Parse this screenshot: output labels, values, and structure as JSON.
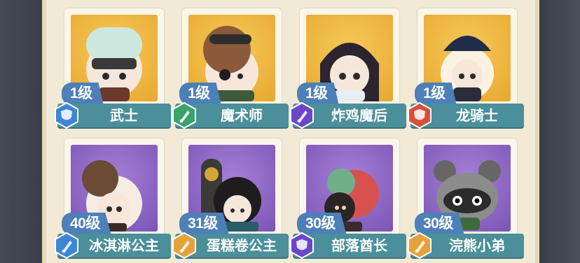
{
  "heroes": [
    {
      "level": "1级",
      "name": "武士",
      "badge": "blue",
      "badge_icon": "shield-icon",
      "bg": "gold"
    },
    {
      "level": "1级",
      "name": "魔术师",
      "badge": "green",
      "badge_icon": "sword-icon",
      "bg": "gold"
    },
    {
      "level": "1级",
      "name": "炸鸡魔后",
      "badge": "purple",
      "badge_icon": "sword-icon",
      "bg": "gold"
    },
    {
      "level": "1级",
      "name": "龙骑士",
      "badge": "red",
      "badge_icon": "shield-icon",
      "bg": "gold"
    },
    {
      "level": "40级",
      "name": "冰淇淋公主",
      "badge": "blue",
      "badge_icon": "sword-icon",
      "bg": "purple"
    },
    {
      "level": "31级",
      "name": "蛋糕卷公主",
      "badge": "orange",
      "badge_icon": "sword-icon",
      "bg": "purple"
    },
    {
      "level": "30级",
      "name": "部落酋长",
      "badge": "purple",
      "badge_icon": "shield-icon",
      "bg": "purple"
    },
    {
      "level": "30级",
      "name": "浣熊小弟",
      "badge": "orange",
      "badge_icon": "sword-icon",
      "bg": "purple"
    }
  ],
  "colors": {
    "blue": "#3d86d6",
    "green": "#3aa36a",
    "purple": "#6a47c7",
    "red": "#d8503a",
    "orange": "#e6a23a",
    "namebar": "#4a8f9a",
    "levelbar": "#4d7fb8"
  }
}
